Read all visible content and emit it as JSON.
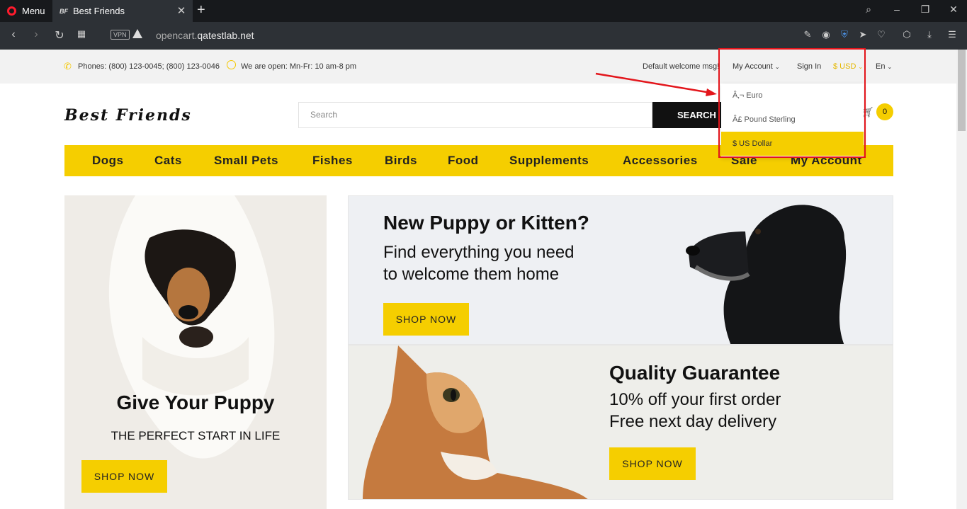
{
  "browser": {
    "menu_label": "Menu",
    "tab_favicon": "BF",
    "tab_title": "Best Friends",
    "vpn_label": "VPN",
    "url_host": "opencart.",
    "url_domain": "qatestlab.net"
  },
  "site": {
    "phones": "Phones: (800) 123-0045; (800) 123-0046",
    "hours": "We are open: Mn-Fr: 10 am-8 pm",
    "welcome": "Default welcome msg!",
    "my_account": "My Account",
    "sign_in": "Sign In",
    "currency": "$ USD",
    "language": "En",
    "currency_options": [
      {
        "label": "Â‚¬ Euro",
        "selected": false
      },
      {
        "label": "Â£ Pound Sterling",
        "selected": false
      },
      {
        "label": "$ US Dollar",
        "selected": true
      }
    ],
    "logo": "Best Friends",
    "search_placeholder": "Search",
    "search_button": "SEARCH",
    "cart_count": "0",
    "nav": [
      "Dogs",
      "Cats",
      "Small Pets",
      "Fishes",
      "Birds",
      "Food",
      "Supplements",
      "Accessories",
      "Sale",
      "My Account"
    ]
  },
  "banners": {
    "left": {
      "title": "Give Your Puppy",
      "subtitle": "THE PERFECT START IN LIFE",
      "button": "SHOP NOW"
    },
    "right_top": {
      "title": "New Puppy or Kitten?",
      "line1": "Find everything you need",
      "line2": "to welcome them home",
      "button": "SHOP NOW"
    },
    "right_bottom": {
      "title": "Quality Guarantee",
      "line1": "10% off your first order",
      "line2": "Free next day delivery",
      "button": "SHOP NOW"
    }
  },
  "colors": {
    "accent": "#f5ce00",
    "highlight_box": "#e3151b"
  }
}
